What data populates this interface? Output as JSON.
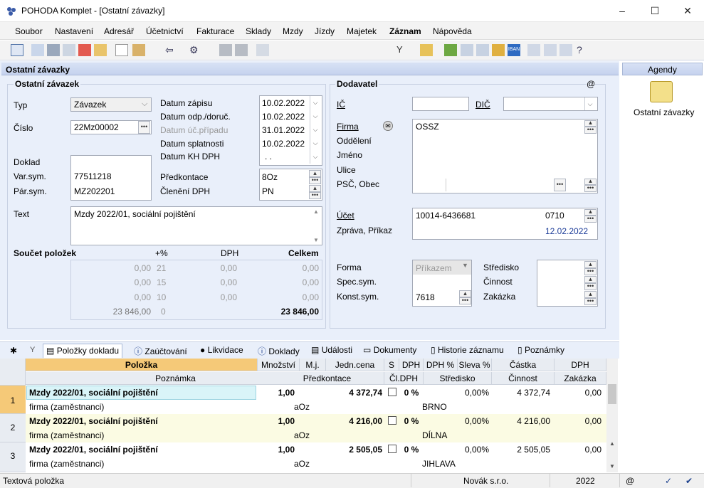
{
  "window": {
    "title": "POHODA Komplet - [Ostatní závazky]",
    "minimize": "–",
    "maximize": "☐",
    "close": "✕"
  },
  "menu": [
    "Soubor",
    "Nastavení",
    "Adresář",
    "Účetnictví",
    "Fakturace",
    "Sklady",
    "Mzdy",
    "Jízdy",
    "Majetek",
    "Záznam",
    "Nápověda"
  ],
  "panel": {
    "title": "Ostatní závazky"
  },
  "zavazek": {
    "section": "Ostatní závazek",
    "typ_label": "Typ",
    "typ_value": "Závazek",
    "cislo_label": "Číslo",
    "cislo_value": "22Mz00002",
    "doklad_label": "Doklad",
    "varsym_label": "Var.sym.",
    "varsym_value": "77511218",
    "parsym_label": "Pár.sym.",
    "parsym_value": "MZ202201",
    "datum_zapisu_label": "Datum zápisu",
    "datum_zapisu": "10.02.2022",
    "datum_odp_label": "Datum odp./doruč.",
    "datum_odp": "10.02.2022",
    "datum_uc_label": "Datum úč.případu",
    "datum_uc": "31.01.2022",
    "datum_splat_label": "Datum splatnosti",
    "datum_splat": "10.02.2022",
    "datum_kh_label": "Datum KH DPH",
    "datum_kh": ". .",
    "predkontace_label": "Předkontace",
    "predkontace": "8Oz",
    "cleneni_label": "Členění DPH",
    "cleneni": "PN",
    "text_label": "Text",
    "text_value": "Mzdy 2022/01, sociální pojištění"
  },
  "soucet": {
    "label": "Součet položek",
    "col_pct": "+%",
    "col_dph": "DPH",
    "col_celkem": "Celkem",
    "rows": [
      {
        "base": "0,00",
        "pct": "21",
        "dph": "0,00",
        "total": "0,00"
      },
      {
        "base": "0,00",
        "pct": "15",
        "dph": "0,00",
        "total": "0,00"
      },
      {
        "base": "0,00",
        "pct": "10",
        "dph": "0,00",
        "total": "0,00"
      },
      {
        "base": "23 846,00",
        "pct": "0",
        "dph": "",
        "total": "23 846,00"
      }
    ]
  },
  "dodavatel": {
    "section": "Dodavatel",
    "at": "@",
    "ic_label": "IČ",
    "dic_label": "DIČ",
    "firma_label": "Firma",
    "firma_value": "OSSZ",
    "oddeleni_label": "Oddělení",
    "jmeno_label": "Jméno",
    "ulice_label": "Ulice",
    "psc_label": "PSČ, Obec",
    "ucet_label": "Účet",
    "ucet_value": "10014-6436681",
    "ucet_code": "0710",
    "zprava_label": "Zpráva, Příkaz",
    "zprava_date": "12.02.2022",
    "forma_label": "Forma",
    "forma_value": "Příkazem",
    "specsym_label": "Spec.sym.",
    "konstsym_label": "Konst.sym.",
    "konstsym_value": "7618",
    "stredisko_label": "Středisko",
    "cinnost_label": "Činnost",
    "zakazka_label": "Zakázka"
  },
  "agendy": {
    "title": "Agendy",
    "item": "Ostatní závazky"
  },
  "tabs": [
    "Položky dokladu",
    "Zaúčtování",
    "Likvidace",
    "Doklady",
    "Události",
    "Dokumenty",
    "Historie záznamu",
    "Poznámky"
  ],
  "grid": {
    "header1": [
      "Položka",
      "Množství",
      "M.j.",
      "Jedn.cena",
      "S",
      "DPH",
      "DPH %",
      "Sleva %",
      "Částka",
      "DPH"
    ],
    "header2": [
      "Poznámka",
      "Předkontace",
      "Čl.DPH",
      "Středisko",
      "Činnost",
      "Zakázka"
    ],
    "rows": [
      {
        "num": "1",
        "name": "Mzdy 2022/01, sociální pojištění",
        "qty": "1,00",
        "price": "4 372,74",
        "dph": "0 %",
        "sleva": "0,00%",
        "castka": "4 372,74",
        "dphval": "0,00",
        "note": "firma (zaměstnanci)",
        "predk": "aOz",
        "stredisko": "BRNO"
      },
      {
        "num": "2",
        "name": "Mzdy 2022/01, sociální pojištění",
        "qty": "1,00",
        "price": "4 216,00",
        "dph": "0 %",
        "sleva": "0,00%",
        "castka": "4 216,00",
        "dphval": "0,00",
        "note": "firma (zaměstnanci)",
        "predk": "aOz",
        "stredisko": "DÍLNA"
      },
      {
        "num": "3",
        "name": "Mzdy 2022/01, sociální pojištění",
        "qty": "1,00",
        "price": "2 505,05",
        "dph": "0 %",
        "sleva": "0,00%",
        "castka": "2 505,05",
        "dphval": "0,00",
        "note": "firma (zaměstnanci)",
        "predk": "aOz",
        "stredisko": "JIHLAVA"
      }
    ]
  },
  "status": {
    "left": "Textová položka",
    "company": "Novák s.r.o.",
    "year": "2022",
    "at": "@"
  }
}
